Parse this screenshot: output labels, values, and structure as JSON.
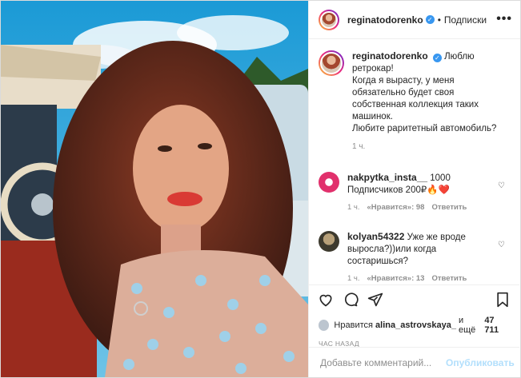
{
  "header": {
    "username": "reginatodorenko",
    "dot": "•",
    "follow_label": "Подписки",
    "more": "•••"
  },
  "caption": {
    "username": "reginatodorenko",
    "text": "Люблю ретрокар!\nКогда я вырасту, у меня обязательно будет своя собственная коллекция таких машинок.\nЛюбите раритетный автомобиль?",
    "time": "1 ч."
  },
  "comments": [
    {
      "username": "nakpytka_insta__",
      "text": "1000 Подписчиков 200₽🔥❤️",
      "time": "1 ч.",
      "likes": "«Нравится»: 98",
      "reply": "Ответить"
    },
    {
      "username": "kolyan54322",
      "text": "Уже же вроде выросла?))или когда состаришься?",
      "time": "1 ч.",
      "likes": "«Нравится»: 13",
      "reply": "Ответить"
    }
  ],
  "likes": {
    "prefix": "Нравится",
    "user": "alina_astrovskaya_",
    "suffix": "и ещё",
    "count": "47 711"
  },
  "posted": "ЧАС НАЗАД",
  "add_comment": {
    "placeholder": "Добавьте комментарий...",
    "publish": "Опубликовать"
  },
  "icons": {
    "like": "heart-icon",
    "comment": "comment-icon",
    "save": "bookmark-icon"
  }
}
